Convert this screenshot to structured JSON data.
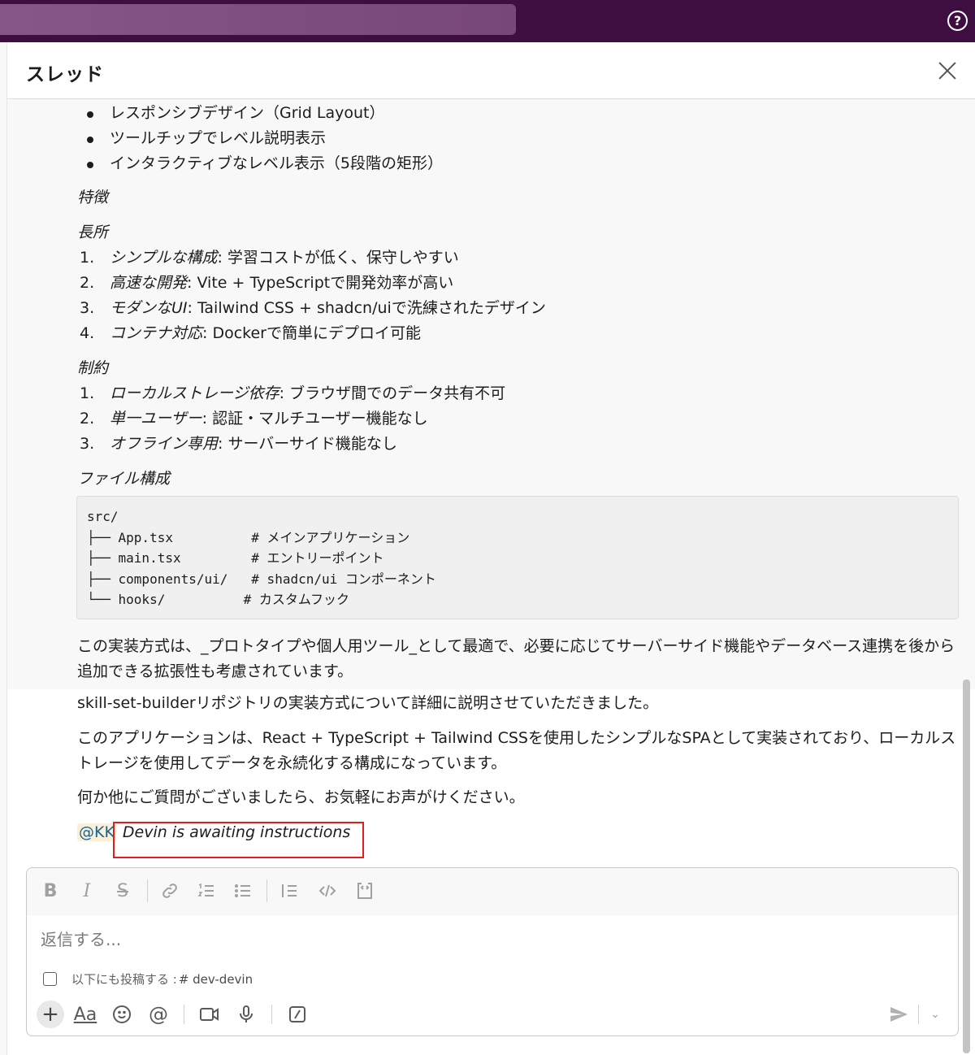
{
  "topbar": {
    "help_label": "?"
  },
  "panel": {
    "title": "スレッド"
  },
  "bullets": [
    "レスポンシブデザイン（Grid Layout）",
    "ツールチップでレベル説明表示",
    "インタラクティブなレベル表示（5段階の矩形）"
  ],
  "section_features": "特徴",
  "section_pros": "長所",
  "pros": [
    {
      "num": "1.",
      "label": "シンプルな構成",
      "text": ": 学習コストが低く、保守しやすい"
    },
    {
      "num": "2.",
      "label": "高速な開発",
      "text": ": Vite + TypeScriptで開発効率が高い"
    },
    {
      "num": "3.",
      "label": "モダンなUI",
      "text": ": Tailwind CSS + shadcn/uiで洗練されたデザイン"
    },
    {
      "num": "4.",
      "label": "コンテナ対応",
      "text": ": Dockerで簡単にデプロイ可能"
    }
  ],
  "section_cons": "制約",
  "cons": [
    {
      "num": "1.",
      "label": "ローカルストレージ依存",
      "text": ": ブラウザ間でのデータ共有不可"
    },
    {
      "num": "2.",
      "label": "単一ユーザー",
      "text": ": 認証・マルチユーザー機能なし"
    },
    {
      "num": "3.",
      "label": "オフライン専用",
      "text": ": サーバーサイド機能なし"
    }
  ],
  "section_files": "ファイル構成",
  "code": "src/\n├── App.tsx          # メインアプリケーション\n├── main.tsx         # エントリーポイント\n├── components/ui/   # shadcn/ui コンポーネント\n└── hooks/          # カスタムフック",
  "closing_para": "この実装方式は、_プロトタイプや個人用ツール_として最適で、必要に応じてサーバーサイド機能やデータベース連携を後から追加できる拡張性も考慮されています。",
  "msg2": {
    "line1": "skill-set-builderリポジトリの実装方式について詳細に説明させていただきました。",
    "line2": "このアプリケーションは、React + TypeScript + Tailwind CSSを使用したシンプルなSPAとして実装されており、ローカルストレージを使用してデータを永続化する構成になっています。",
    "line3": "何か他にご質問がございましたら、お気軽にお声がけください。",
    "mention": "@KK",
    "status": "Devin is awaiting instructions"
  },
  "composer": {
    "placeholder": "返信する...",
    "also_post_label": "以下にも投稿する :",
    "channel": "# dev-devin",
    "format_text_label": "Aa"
  },
  "colors": {
    "topbar": "#3f0e40",
    "mention_bg": "#fdf1d5",
    "mention_fg": "#1264a3",
    "highlight_box": "#e01e1e"
  }
}
